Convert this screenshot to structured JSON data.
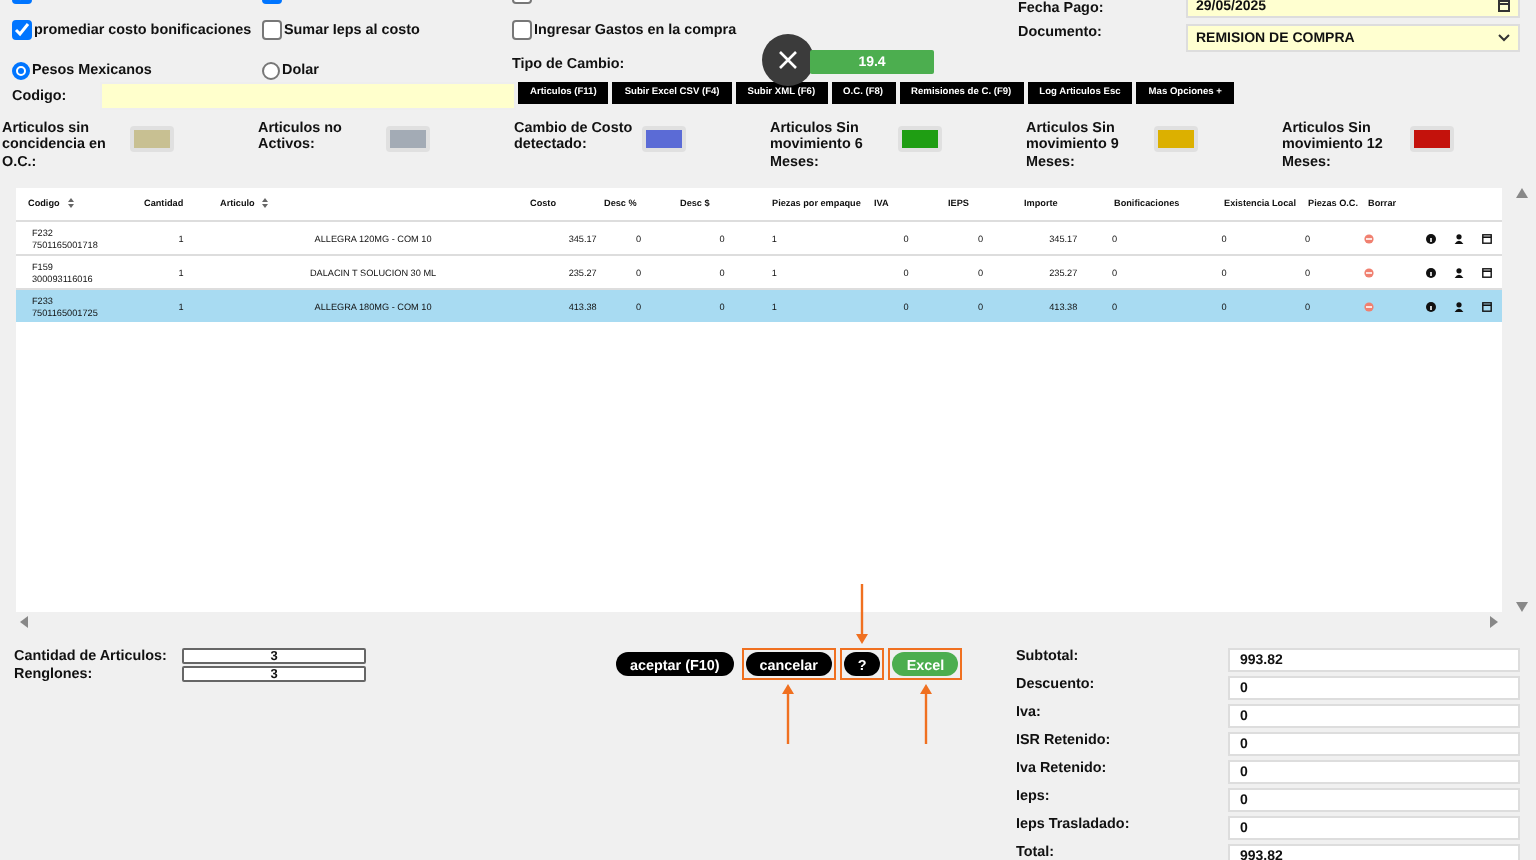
{
  "top_partial_checkboxes": [
    {
      "checked": true
    },
    {
      "checked": true
    },
    {
      "checked": false
    }
  ],
  "options": [
    {
      "label": "promediar costo bonificaciones",
      "checked": true
    },
    {
      "label": "Sumar Ieps al costo",
      "checked": false
    },
    {
      "label": "Ingresar Gastos en la compra",
      "checked": false
    }
  ],
  "fecha_pago": {
    "label": "Fecha Pago:",
    "value": "29/05/2025"
  },
  "documento": {
    "label": "Documento:",
    "value": "REMISION DE COMPRA"
  },
  "currency": [
    {
      "label": "Pesos Mexicanos",
      "selected": true
    },
    {
      "label": "Dolar",
      "selected": false
    }
  ],
  "tipo_de_cambio": {
    "label": "Tipo de Cambio:",
    "value": "19.4"
  },
  "codigo": {
    "label": "Codigo:"
  },
  "toolbar": [
    "Articulos (F11)",
    "Subir Excel CSV (F4)",
    "Subir XML (F6)",
    "O.C. (F8)",
    "Remisiones de C. (F9)",
    "Log Articulos Esc",
    "Mas Opciones +"
  ],
  "legend": [
    {
      "label": "Articulos sin concidencia en O.C.:",
      "color": "#c8c092"
    },
    {
      "label": "Articulos no Activos:",
      "color": "#a3abb5"
    },
    {
      "label": "Cambio de Costo detectado:",
      "color": "#5b6bd6"
    },
    {
      "label": "Articulos Sin movimiento 6 Meses:",
      "color": "#1f9e13"
    },
    {
      "label": "Articulos Sin movimiento 9 Meses:",
      "color": "#dcb000"
    },
    {
      "label": "Articulos Sin movimiento 12 Meses:",
      "color": "#c4120c"
    }
  ],
  "table": {
    "columns": [
      "Codigo",
      "Cantidad",
      "Articulo",
      "Costo",
      "Desc %",
      "Desc $",
      "Piezas por empaque",
      "IVA",
      "IEPS",
      "Importe",
      "Bonificaciones",
      "Existencia Local",
      "Piezas O.C.",
      "Borrar"
    ],
    "rows": [
      {
        "codigo": "F232",
        "barcode": "7501165001718",
        "cantidad": "1",
        "articulo": "ALLEGRA 120MG - COM 10",
        "costo": "345.17",
        "desc_pct": "0",
        "desc_amt": "0",
        "piezas": "1",
        "iva": "0",
        "ieps": "0",
        "importe": "345.17",
        "bonificaciones": "0",
        "existencia": "0",
        "piezas_oc": "0",
        "selected": false
      },
      {
        "codigo": "F159",
        "barcode": "300093116016",
        "cantidad": "1",
        "articulo": "DALACIN T SOLUCION 30 ML",
        "costo": "235.27",
        "desc_pct": "0",
        "desc_amt": "0",
        "piezas": "1",
        "iva": "0",
        "ieps": "0",
        "importe": "235.27",
        "bonificaciones": "0",
        "existencia": "0",
        "piezas_oc": "0",
        "selected": false
      },
      {
        "codigo": "F233",
        "barcode": "7501165001725",
        "cantidad": "1",
        "articulo": "ALLEGRA 180MG - COM 10",
        "costo": "413.38",
        "desc_pct": "0",
        "desc_amt": "0",
        "piezas": "1",
        "iva": "0",
        "ieps": "0",
        "importe": "413.38",
        "bonificaciones": "0",
        "existencia": "0",
        "piezas_oc": "0",
        "selected": true
      }
    ]
  },
  "counts": [
    {
      "label": "Cantidad de Articulos:",
      "value": "3"
    },
    {
      "label": "Renglones:",
      "value": "3"
    }
  ],
  "actions": [
    {
      "label": "aceptar (F10)",
      "kind": "dark",
      "highlighted": false
    },
    {
      "label": "cancelar",
      "kind": "dark",
      "highlighted": true,
      "arrow_from_below": true
    },
    {
      "label": "?",
      "kind": "dark",
      "highlighted": true,
      "arrow_from_below": false
    },
    {
      "label": "Excel",
      "kind": "green",
      "highlighted": true,
      "arrow_from_below": true
    }
  ],
  "totals": [
    {
      "label": "Subtotal:",
      "value": "993.82"
    },
    {
      "label": "Descuento:",
      "value": "0"
    },
    {
      "label": "Iva:",
      "value": "0"
    },
    {
      "label": "ISR Retenido:",
      "value": "0"
    },
    {
      "label": "Iva Retenido:",
      "value": "0"
    },
    {
      "label": "Ieps:",
      "value": "0"
    },
    {
      "label": "Ieps Trasladado:",
      "value": "0"
    },
    {
      "label": "Total:",
      "value": "993.82"
    }
  ]
}
